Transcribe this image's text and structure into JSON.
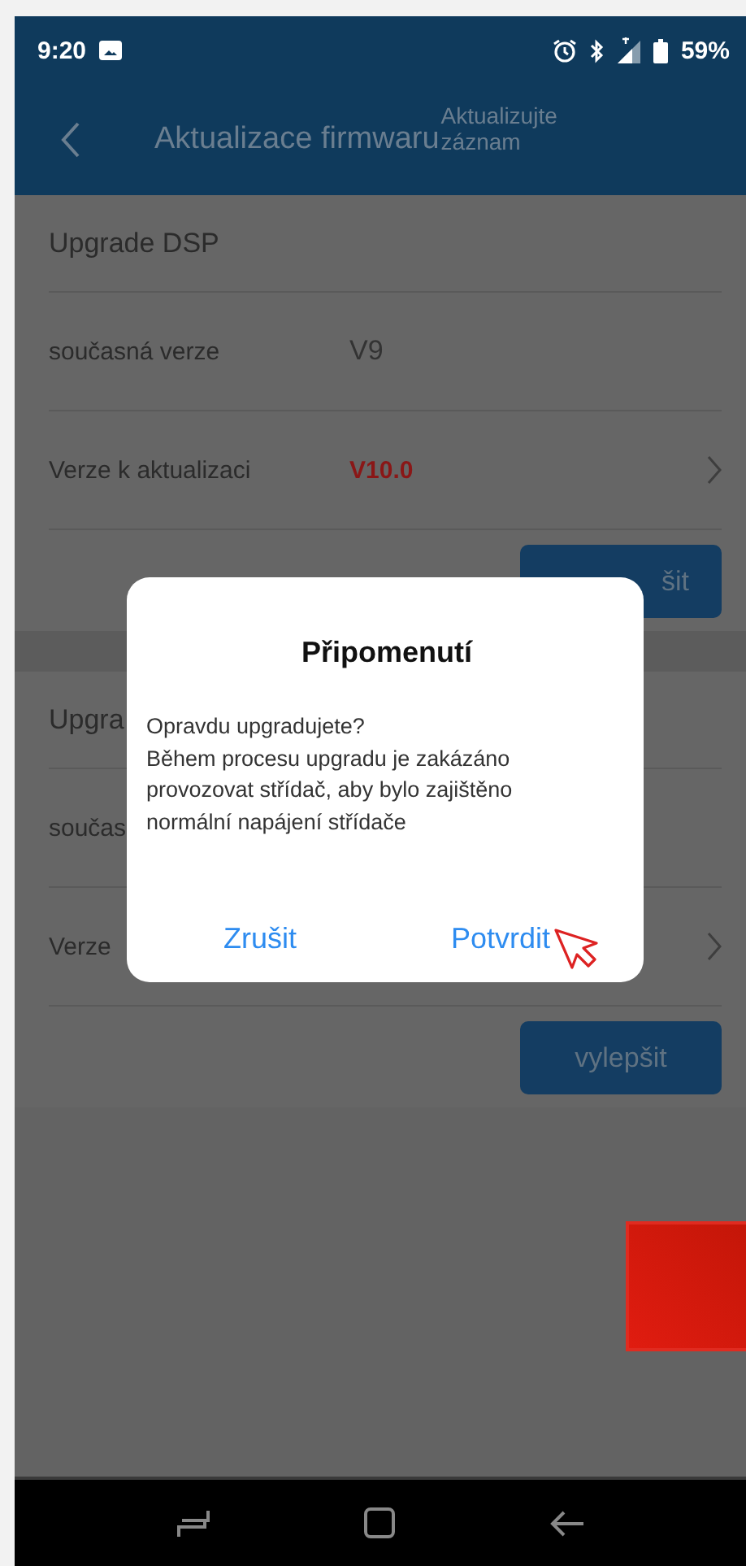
{
  "status_bar": {
    "time": "9:20",
    "battery": "59%"
  },
  "header": {
    "title": "Aktualizace firmwaru",
    "action": "Aktualizujte záznam"
  },
  "sections": [
    {
      "title": "Upgrade DSP",
      "rows": [
        {
          "kind": "plain",
          "label": "současná verze",
          "value": "V9"
        },
        {
          "kind": "link",
          "label": "Verze k aktualizaci",
          "value": "V10.0"
        }
      ],
      "button": "šit"
    },
    {
      "title": "Upgra",
      "rows": [
        {
          "kind": "plain",
          "label": "součas"
        },
        {
          "kind": "link",
          "label": "Verze"
        }
      ],
      "button": "vylepšit"
    }
  ],
  "dialog": {
    "title": "Připomenutí",
    "message": "Opravdu upgradujete?\nBěhem procesu upgradu je zakázáno\nprovozovat střídač, aby bylo zajištěno\nnormální napájení střídače",
    "buttons": [
      {
        "label": "Zrušit"
      },
      {
        "label": "Potvrdit"
      }
    ]
  }
}
